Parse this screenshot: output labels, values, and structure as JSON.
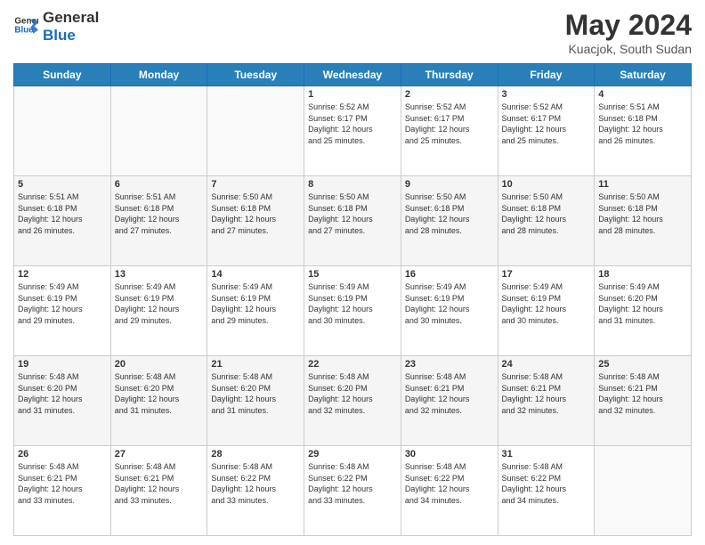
{
  "header": {
    "logo_line1": "General",
    "logo_line2": "Blue",
    "title": "May 2024",
    "subtitle": "Kuacjok, South Sudan"
  },
  "days_of_week": [
    "Sunday",
    "Monday",
    "Tuesday",
    "Wednesday",
    "Thursday",
    "Friday",
    "Saturday"
  ],
  "weeks": [
    [
      {
        "day": "",
        "info": ""
      },
      {
        "day": "",
        "info": ""
      },
      {
        "day": "",
        "info": ""
      },
      {
        "day": "1",
        "info": "Sunrise: 5:52 AM\nSunset: 6:17 PM\nDaylight: 12 hours\nand 25 minutes."
      },
      {
        "day": "2",
        "info": "Sunrise: 5:52 AM\nSunset: 6:17 PM\nDaylight: 12 hours\nand 25 minutes."
      },
      {
        "day": "3",
        "info": "Sunrise: 5:52 AM\nSunset: 6:17 PM\nDaylight: 12 hours\nand 25 minutes."
      },
      {
        "day": "4",
        "info": "Sunrise: 5:51 AM\nSunset: 6:18 PM\nDaylight: 12 hours\nand 26 minutes."
      }
    ],
    [
      {
        "day": "5",
        "info": "Sunrise: 5:51 AM\nSunset: 6:18 PM\nDaylight: 12 hours\nand 26 minutes."
      },
      {
        "day": "6",
        "info": "Sunrise: 5:51 AM\nSunset: 6:18 PM\nDaylight: 12 hours\nand 27 minutes."
      },
      {
        "day": "7",
        "info": "Sunrise: 5:50 AM\nSunset: 6:18 PM\nDaylight: 12 hours\nand 27 minutes."
      },
      {
        "day": "8",
        "info": "Sunrise: 5:50 AM\nSunset: 6:18 PM\nDaylight: 12 hours\nand 27 minutes."
      },
      {
        "day": "9",
        "info": "Sunrise: 5:50 AM\nSunset: 6:18 PM\nDaylight: 12 hours\nand 28 minutes."
      },
      {
        "day": "10",
        "info": "Sunrise: 5:50 AM\nSunset: 6:18 PM\nDaylight: 12 hours\nand 28 minutes."
      },
      {
        "day": "11",
        "info": "Sunrise: 5:50 AM\nSunset: 6:18 PM\nDaylight: 12 hours\nand 28 minutes."
      }
    ],
    [
      {
        "day": "12",
        "info": "Sunrise: 5:49 AM\nSunset: 6:19 PM\nDaylight: 12 hours\nand 29 minutes."
      },
      {
        "day": "13",
        "info": "Sunrise: 5:49 AM\nSunset: 6:19 PM\nDaylight: 12 hours\nand 29 minutes."
      },
      {
        "day": "14",
        "info": "Sunrise: 5:49 AM\nSunset: 6:19 PM\nDaylight: 12 hours\nand 29 minutes."
      },
      {
        "day": "15",
        "info": "Sunrise: 5:49 AM\nSunset: 6:19 PM\nDaylight: 12 hours\nand 30 minutes."
      },
      {
        "day": "16",
        "info": "Sunrise: 5:49 AM\nSunset: 6:19 PM\nDaylight: 12 hours\nand 30 minutes."
      },
      {
        "day": "17",
        "info": "Sunrise: 5:49 AM\nSunset: 6:19 PM\nDaylight: 12 hours\nand 30 minutes."
      },
      {
        "day": "18",
        "info": "Sunrise: 5:49 AM\nSunset: 6:20 PM\nDaylight: 12 hours\nand 31 minutes."
      }
    ],
    [
      {
        "day": "19",
        "info": "Sunrise: 5:48 AM\nSunset: 6:20 PM\nDaylight: 12 hours\nand 31 minutes."
      },
      {
        "day": "20",
        "info": "Sunrise: 5:48 AM\nSunset: 6:20 PM\nDaylight: 12 hours\nand 31 minutes."
      },
      {
        "day": "21",
        "info": "Sunrise: 5:48 AM\nSunset: 6:20 PM\nDaylight: 12 hours\nand 31 minutes."
      },
      {
        "day": "22",
        "info": "Sunrise: 5:48 AM\nSunset: 6:20 PM\nDaylight: 12 hours\nand 32 minutes."
      },
      {
        "day": "23",
        "info": "Sunrise: 5:48 AM\nSunset: 6:21 PM\nDaylight: 12 hours\nand 32 minutes."
      },
      {
        "day": "24",
        "info": "Sunrise: 5:48 AM\nSunset: 6:21 PM\nDaylight: 12 hours\nand 32 minutes."
      },
      {
        "day": "25",
        "info": "Sunrise: 5:48 AM\nSunset: 6:21 PM\nDaylight: 12 hours\nand 32 minutes."
      }
    ],
    [
      {
        "day": "26",
        "info": "Sunrise: 5:48 AM\nSunset: 6:21 PM\nDaylight: 12 hours\nand 33 minutes."
      },
      {
        "day": "27",
        "info": "Sunrise: 5:48 AM\nSunset: 6:21 PM\nDaylight: 12 hours\nand 33 minutes."
      },
      {
        "day": "28",
        "info": "Sunrise: 5:48 AM\nSunset: 6:22 PM\nDaylight: 12 hours\nand 33 minutes."
      },
      {
        "day": "29",
        "info": "Sunrise: 5:48 AM\nSunset: 6:22 PM\nDaylight: 12 hours\nand 33 minutes."
      },
      {
        "day": "30",
        "info": "Sunrise: 5:48 AM\nSunset: 6:22 PM\nDaylight: 12 hours\nand 34 minutes."
      },
      {
        "day": "31",
        "info": "Sunrise: 5:48 AM\nSunset: 6:22 PM\nDaylight: 12 hours\nand 34 minutes."
      },
      {
        "day": "",
        "info": ""
      }
    ]
  ]
}
